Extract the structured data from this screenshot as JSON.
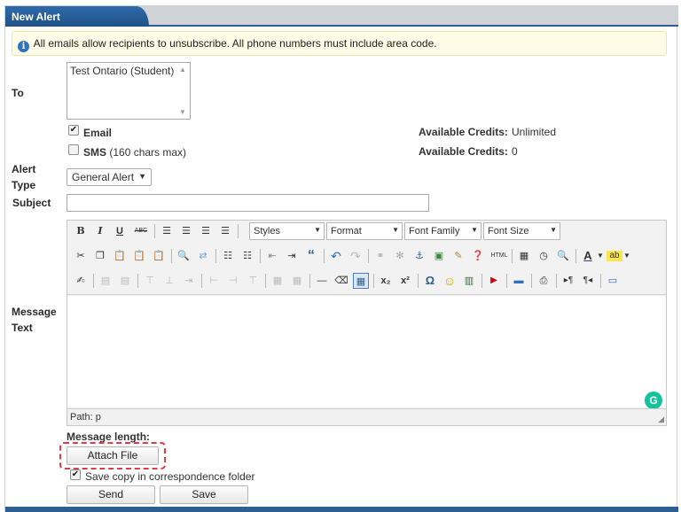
{
  "tab": {
    "title": "New Alert"
  },
  "info": {
    "message": "All emails allow recipients to unsubscribe. All phone numbers must include area code."
  },
  "labels": {
    "to": "To",
    "alert_type_line1": "Alert",
    "alert_type_line2": "Type",
    "subject": "Subject",
    "message_text_line1": "Message",
    "message_text_line2": "Text",
    "message_length": "Message length:"
  },
  "recipients": [
    "Test Ontario (Student)"
  ],
  "channels": {
    "email": {
      "label": "Email",
      "checked": true,
      "credits_label": "Available Credits:",
      "credits_value": "Unlimited"
    },
    "sms": {
      "label": "SMS",
      "note": "(160 chars max)",
      "checked": false,
      "credits_label": "Available Credits:",
      "credits_value": "0"
    }
  },
  "alert_type": {
    "selected": "General Alert"
  },
  "subject": {
    "value": ""
  },
  "editor": {
    "dropdowns": {
      "styles": "Styles",
      "format": "Format",
      "font_family": "Font Family",
      "font_size": "Font Size"
    },
    "path": "Path: p",
    "icons": [
      "bold-icon",
      "italic-icon",
      "underline-icon",
      "strikethrough-icon",
      "align-left-icon",
      "align-center-icon",
      "align-right-icon",
      "align-justify-icon",
      "cut-icon",
      "copy-icon",
      "paste-icon",
      "paste-text-icon",
      "paste-word-icon",
      "find-icon",
      "replace-icon",
      "bullet-list-icon",
      "numbered-list-icon",
      "outdent-icon",
      "indent-icon",
      "blockquote-icon",
      "undo-icon",
      "redo-icon",
      "link-icon",
      "unlink-icon",
      "anchor-icon",
      "image-icon",
      "cleanup-icon",
      "help-icon",
      "html-icon",
      "insert-date-icon",
      "insert-time-icon",
      "preview-icon",
      "text-color-icon",
      "highlight-color-icon",
      "table-icon",
      "horizontal-rule-icon",
      "remove-format-icon",
      "subscript-icon",
      "superscript-icon",
      "omega-icon",
      "emoticon-icon",
      "media-icon",
      "youtube-icon",
      "print-icon",
      "ltr-icon",
      "rtl-icon",
      "fullscreen-icon"
    ],
    "glyphs": {
      "bold": "B",
      "italic": "I",
      "underline": "U",
      "strike": "ABC",
      "subscript": "x₂",
      "superscript": "x²",
      "omega": "Ω",
      "html": "HTML",
      "quote": "“",
      "text_color": "A",
      "highlight": "ab"
    }
  },
  "grammarly": {
    "glyph": "G"
  },
  "actions": {
    "attach_file": "Attach File",
    "save_copy": {
      "label": "Save copy in correspondence folder",
      "checked": true
    },
    "send": "Send",
    "save": "Save"
  },
  "colors": {
    "tab_bg": "#2e6aa8",
    "info_bg": "#fefbe6",
    "highlight_border": "#e23a4b",
    "grammarly": "#15c39a"
  }
}
